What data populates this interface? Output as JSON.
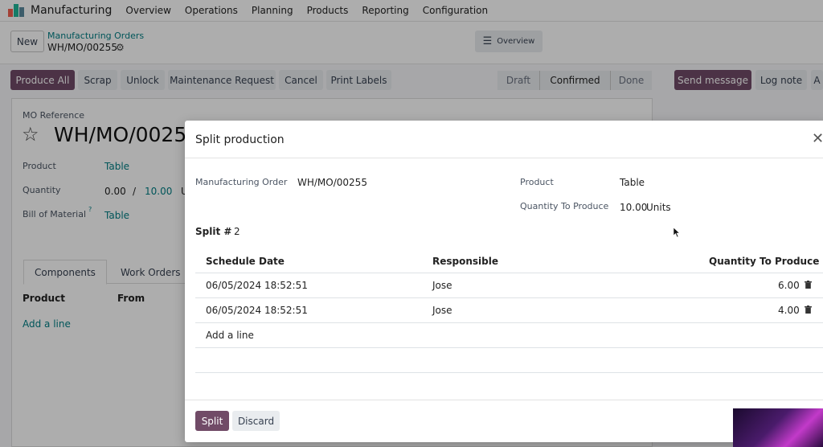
{
  "app": {
    "title": "Manufacturing",
    "logo_colors": [
      "#f06050",
      "#21b799",
      "#5b899e"
    ]
  },
  "nav": {
    "items": [
      "Overview",
      "Operations",
      "Planning",
      "Products",
      "Reporting",
      "Configuration"
    ]
  },
  "control": {
    "new_label": "New",
    "breadcrumb_parent": "Manufacturing Orders",
    "breadcrumb_current": "WH/MO/00255",
    "view_label": "Overview"
  },
  "actions": {
    "buttons": [
      "Produce All",
      "Scrap",
      "Unlock",
      "Maintenance Request",
      "Cancel",
      "Print Labels"
    ],
    "status_steps": [
      "Draft",
      "Confirmed",
      "Done"
    ],
    "status_active": "Confirmed",
    "chatter": {
      "send": "Send message",
      "log": "Log note",
      "more": "A"
    }
  },
  "form": {
    "ref_label": "MO Reference",
    "ref_value": "WH/MO/0025",
    "product_label": "Product",
    "product_value": "Table",
    "quantity_label": "Quantity",
    "qty_done": "0.00",
    "qty_sep": "/",
    "qty_total": "10.00",
    "qty_unit": "U",
    "bom_label": "Bill of Material",
    "bom_help": "?",
    "bom_value": "Table",
    "tabs": [
      "Components",
      "Work Orders"
    ],
    "col_product": "Product",
    "col_from": "From",
    "add_line": "Add a line"
  },
  "modal": {
    "title": "Split production",
    "mo_label": "Manufacturing Order",
    "mo_value": "WH/MO/00255",
    "product_label": "Product",
    "product_value": "Table",
    "qty_label": "Quantity To Produce",
    "qty_value": "10.00",
    "qty_unit": "Units",
    "split_label": "Split #",
    "split_value": "2",
    "columns": [
      "Schedule Date",
      "Responsible",
      "Quantity To Produce"
    ],
    "rows": [
      {
        "date": "06/05/2024 18:52:51",
        "responsible": "Jose",
        "qty": "6.00"
      },
      {
        "date": "06/05/2024 18:52:51",
        "responsible": "Jose",
        "qty": "4.00"
      }
    ],
    "add_line": "Add a line",
    "split_button": "Split",
    "discard_button": "Discard"
  }
}
